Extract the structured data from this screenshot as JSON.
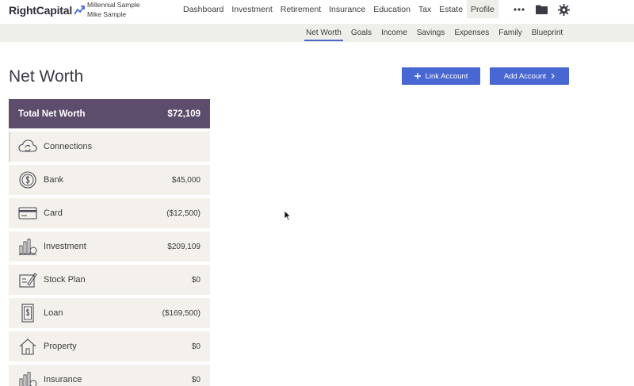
{
  "brand": {
    "logo_text": "RightCapital"
  },
  "client": {
    "plan": "Millennial Sample",
    "name": "Mike Sample"
  },
  "main_nav": [
    {
      "label": "Dashboard"
    },
    {
      "label": "Investment"
    },
    {
      "label": "Retirement"
    },
    {
      "label": "Insurance"
    },
    {
      "label": "Education"
    },
    {
      "label": "Tax"
    },
    {
      "label": "Estate"
    },
    {
      "label": "Profile",
      "active": true
    }
  ],
  "nav_icons": [
    "more-icon",
    "folder-icon",
    "gear-icon"
  ],
  "sub_nav": [
    {
      "label": "Net Worth",
      "active": true
    },
    {
      "label": "Goals"
    },
    {
      "label": "Income"
    },
    {
      "label": "Savings"
    },
    {
      "label": "Expenses"
    },
    {
      "label": "Family"
    },
    {
      "label": "Blueprint"
    }
  ],
  "page": {
    "title": "Net Worth",
    "link_account_label": "Link Account",
    "add_account_label": "Add Account"
  },
  "summary": {
    "label": "Total Net Worth",
    "value": "$72,109"
  },
  "categories": [
    {
      "label": "Connections",
      "value": "",
      "icon": "cloud-sync-icon"
    },
    {
      "label": "Bank",
      "value": "$45,000",
      "icon": "coin-icon"
    },
    {
      "label": "Card",
      "value": "($12,500)",
      "icon": "credit-card-icon"
    },
    {
      "label": "Investment",
      "value": "$209,109",
      "icon": "investment-chart-icon"
    },
    {
      "label": "Stock Plan",
      "value": "$0",
      "icon": "stock-plan-icon"
    },
    {
      "label": "Loan",
      "value": "($169,500)",
      "icon": "loan-document-icon"
    },
    {
      "label": "Property",
      "value": "$0",
      "icon": "house-icon"
    },
    {
      "label": "Insurance",
      "value": "$0",
      "icon": "insurance-icon"
    }
  ],
  "colors": {
    "accent": "#4867d2",
    "summary_bg": "#5c4d6c",
    "row_bg": "#f4f1ec",
    "subnav_bg": "#efefea"
  }
}
